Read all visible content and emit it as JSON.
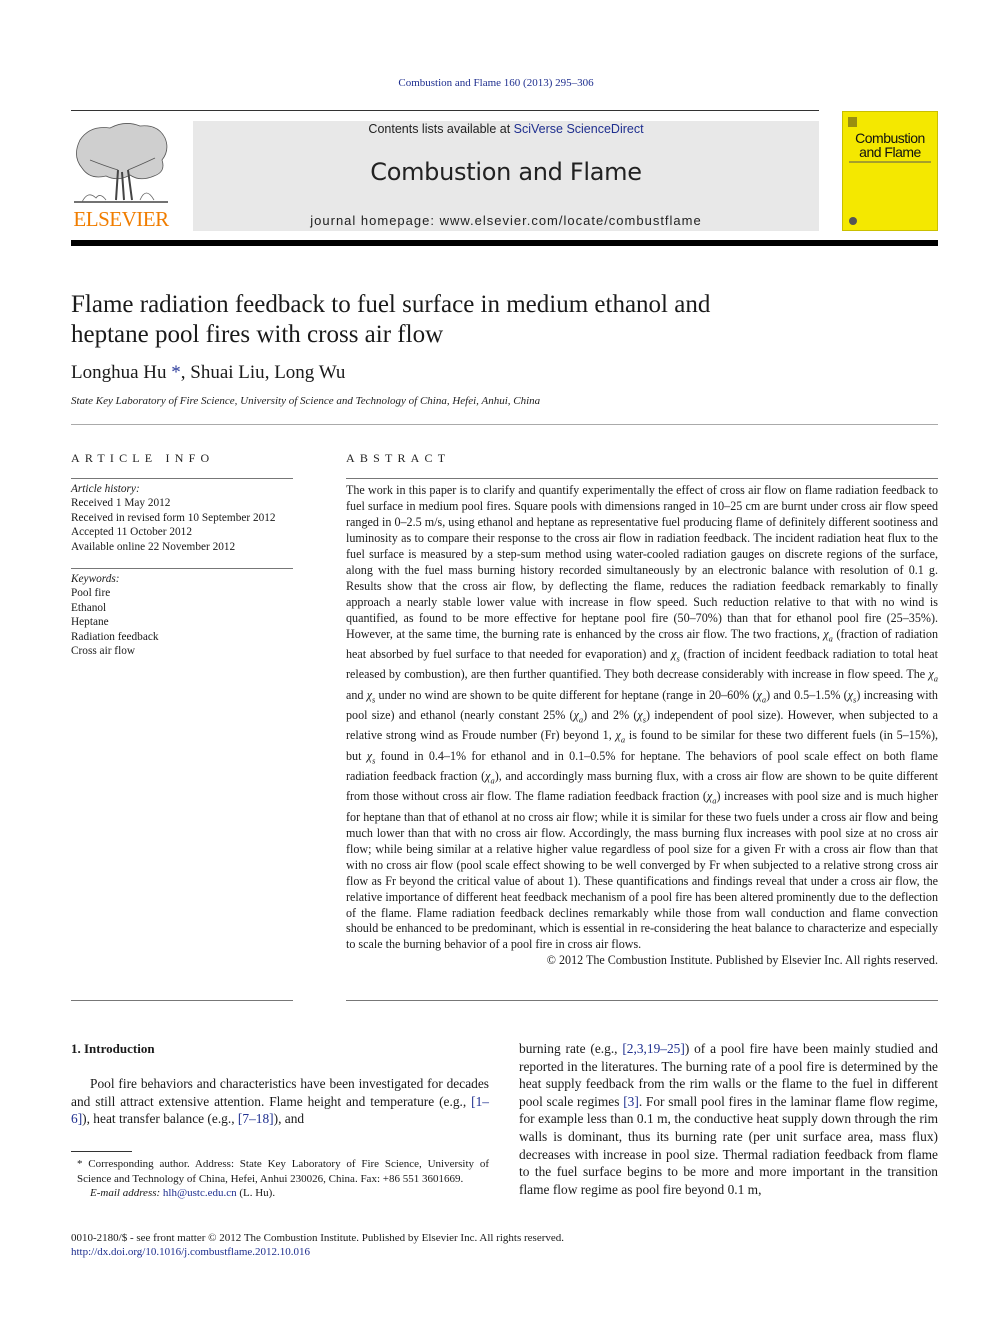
{
  "header": {
    "citation": "Combustion and Flame 160 (2013) 295–306",
    "contents_prefix": "Contents lists available at ",
    "contents_link": "SciVerse ScienceDirect",
    "journal_name": "Combustion and Flame",
    "homepage_prefix": "journal homepage: ",
    "homepage_url": "www.elsevier.com/locate/combustflame",
    "publisher_logo": "ELSEVIER",
    "cover_title_line1": "Combustion",
    "cover_title_line2": "and Flame"
  },
  "article": {
    "title": "Flame radiation feedback to fuel surface in medium ethanol and heptane pool fires with cross air flow",
    "authors": [
      {
        "name": "Longhua Hu",
        "marker": "*"
      },
      {
        "name": "Shuai Liu"
      },
      {
        "name": "Long Wu"
      }
    ],
    "author_separator": ", ",
    "affiliation": "State Key Laboratory of Fire Science, University of Science and Technology of China, Hefei, Anhui, China"
  },
  "article_info": {
    "heading": "ARTICLE INFO",
    "history_label": "Article history:",
    "history": [
      "Received 1 May 2012",
      "Received in revised form 10 September 2012",
      "Accepted 11 October 2012",
      "Available online 22 November 2012"
    ],
    "keywords_label": "Keywords:",
    "keywords": [
      "Pool fire",
      "Ethanol",
      "Heptane",
      "Radiation feedback",
      "Cross air flow"
    ]
  },
  "abstract": {
    "heading": "ABSTRACT",
    "segments": [
      "The work in this paper is to clarify and quantify experimentally the effect of cross air flow on flame radiation feedback to fuel surface in medium pool fires. Square pools with dimensions ranged in 10–25 cm are burnt under cross air flow speed ranged in 0–2.5 m/s, using ethanol and heptane as representative fuel producing flame of definitely different sootiness and luminosity as to compare their response to the cross air flow in radiation feedback. The incident radiation heat flux to the fuel surface is measured by a step-sum method using water-cooled radiation gauges on discrete regions of the surface, along with the fuel mass burning history recorded simultaneously by an electronic balance with resolution of 0.1 g. Results show that the cross air flow, by deflecting the flame, reduces the radiation feedback remarkably to finally approach a nearly stable lower value with increase in flow speed. Such reduction relative to that with no wind is quantified, as found to be more effective for heptane pool fire (50–70%) than that for ethanol pool fire (25–35%). However, at the same time, the burning rate is enhanced by the cross air flow. The two fractions, ",
      " (fraction of radiation heat absorbed by fuel surface to that needed for evaporation) and ",
      " (fraction of incident feedback radiation to total heat released by combustion), are then further quantified. They both decrease considerably with increase in flow speed. The ",
      " and ",
      " under no wind are shown to be quite different for heptane (range in 20–60% (",
      ") and 0.5–1.5% (",
      ") increasing with pool size) and ethanol (nearly constant 25% (",
      ") and 2% (",
      ") independent of pool size). However, when subjected to a relative strong wind as Froude number (Fr) beyond 1, ",
      " is found to be similar for these two different fuels (in 5–15%), but ",
      " found in 0.4–1% for ethanol and in 0.1–0.5% for heptane. The behaviors of pool scale effect on both flame radiation feedback fraction (",
      "), and accordingly mass burning flux, with a cross air flow are shown to be quite different from those without cross air flow. The flame radiation feedback fraction (",
      ") increases with pool size and is much higher for heptane than that of ethanol at no cross air flow; while it is similar for these two fuels under a cross air flow and being much lower than that with no cross air flow. Accordingly, the mass burning flux increases with pool size at no cross air flow; while being similar at a relative higher value regardless of pool size for a given Fr with a cross air flow than that with no cross air flow (pool scale effect showing to be well converged by Fr when subjected to a relative strong cross air flow as Fr beyond the critical value of about 1). These quantifications and findings reveal that under a cross air flow, the relative importance of different heat feedback mechanism of a pool fire has been altered prominently due to the deflection of the flame. Flame radiation feedback declines remarkably while those from wall conduction and flame convection should be enhanced to be predominant, which is essential in re-considering the heat balance to characterize and especially to scale the burning behavior of a pool fire in cross air flows."
    ],
    "symbols": {
      "chi_a": "χa",
      "chi_s": "χs"
    },
    "copyright": "© 2012 The Combustion Institute. Published by Elsevier Inc. All rights reserved."
  },
  "introduction": {
    "heading": "1. Introduction",
    "left_text_1": "Pool fire behaviors and characteristics have been investigated for decades and still attract extensive attention. Flame height and temperature (e.g., ",
    "ref_1": "[1–6]",
    "left_text_2": "), heat transfer balance (e.g., ",
    "ref_2": "[7–18]",
    "left_text_3": "), and",
    "right_text_1": "burning rate (e.g., ",
    "ref_3": "[2,3,19–25]",
    "right_text_2": ") of a pool fire have been mainly studied and reported in the literatures. The burning rate of a pool fire is determined by the heat supply feedback from the rim walls or the flame to the fuel in different pool scale regimes ",
    "ref_4": "[3]",
    "right_text_3": ". For small pool fires in the laminar flame flow regime, for example less than 0.1 m, the conductive heat supply down through the rim walls is dominant, thus its burning rate (per unit surface area, mass flux) decreases with increase in pool size. Thermal radiation feedback from flame to the fuel surface begins to be more and more important in the transition flame flow regime as pool fire beyond 0.1 m,"
  },
  "footnote": {
    "marker": "*",
    "text": " Corresponding author. Address: State Key Laboratory of Fire Science, University of Science and Technology of China, Hefei, Anhui 230026, China. Fax: +86 551 3601669.",
    "email_label": "E-mail address:",
    "email": "hlh@ustc.edu.cn",
    "email_suffix": " (L. Hu)."
  },
  "front_matter": {
    "issn_line": "0010-2180/$ - see front matter © 2012 The Combustion Institute. Published by Elsevier Inc. All rights reserved.",
    "doi": "http://dx.doi.org/10.1016/j.combustflame.2012.10.016"
  }
}
